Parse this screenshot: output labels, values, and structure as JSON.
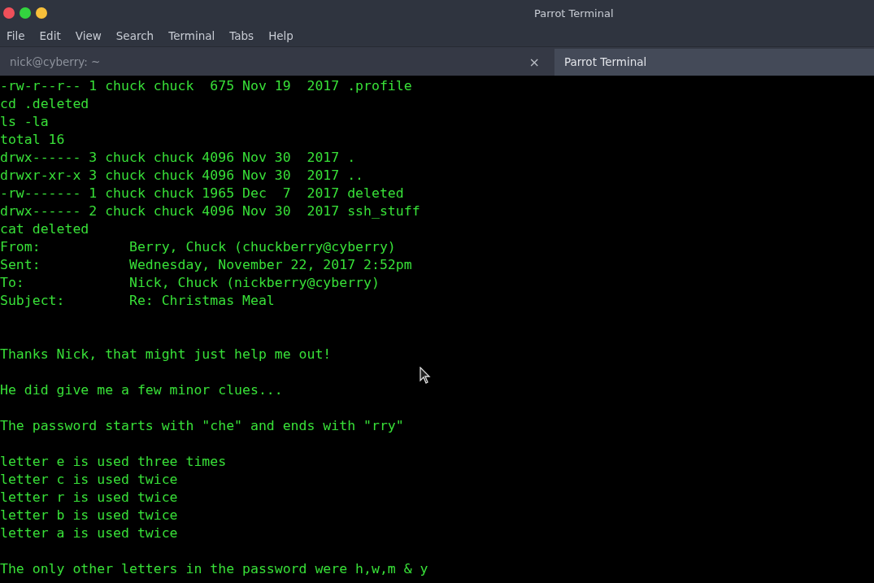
{
  "window": {
    "title": "Parrot Terminal",
    "controls": [
      {
        "color": "#f0505a"
      },
      {
        "color": "#33d43f"
      },
      {
        "color": "#f8c03a"
      }
    ]
  },
  "menu": [
    "File",
    "Edit",
    "View",
    "Search",
    "Terminal",
    "Tabs",
    "Help"
  ],
  "tabs": [
    {
      "label": "nick@cyberry: ~",
      "close": "×",
      "selected": false
    },
    {
      "label": "Parrot Terminal",
      "selected": true
    }
  ],
  "terminal": {
    "lines": [
      {
        "kind": "text",
        "text": "-rw-r--r-- 1 chuck chuck  675 Nov 19  2017 .profile"
      },
      {
        "kind": "text",
        "text": "cd .deleted"
      },
      {
        "kind": "text",
        "text": "ls -la"
      },
      {
        "kind": "text",
        "text": "total 16"
      },
      {
        "kind": "text",
        "text": "drwx------ 3 chuck chuck 4096 Nov 30  2017 ."
      },
      {
        "kind": "text",
        "text": "drwxr-xr-x 3 chuck chuck 4096 Nov 30  2017 .."
      },
      {
        "kind": "text",
        "text": "-rw------- 1 chuck chuck 1965 Dec  7  2017 deleted"
      },
      {
        "kind": "text",
        "text": "drwx------ 2 chuck chuck 4096 Nov 30  2017 ssh_stuff"
      },
      {
        "kind": "text",
        "text": "cat deleted"
      },
      {
        "kind": "text",
        "text": "From:           Berry, Chuck (chuckberry@cyberry)"
      },
      {
        "kind": "text",
        "text": "Sent:           Wednesday, November 22, 2017 2:52pm"
      },
      {
        "kind": "text",
        "text": "To:             Nick, Chuck (nickberry@cyberry)"
      },
      {
        "kind": "text",
        "text": "Subject:        Re: Christmas Meal"
      },
      {
        "kind": "blank"
      },
      {
        "kind": "blank"
      },
      {
        "kind": "text",
        "text": "Thanks Nick, that might just help me out!"
      },
      {
        "kind": "blank"
      },
      {
        "kind": "text",
        "text": "He did give me a few minor clues..."
      },
      {
        "kind": "blank"
      },
      {
        "kind": "text",
        "text": "The password starts with \"che\" and ends with \"rry\""
      },
      {
        "kind": "blank"
      },
      {
        "kind": "text",
        "text": "letter e is used three times"
      },
      {
        "kind": "text",
        "text": "letter c is used twice"
      },
      {
        "kind": "text",
        "text": "letter r is used twice"
      },
      {
        "kind": "text",
        "text": "letter b is used twice"
      },
      {
        "kind": "text",
        "text": "letter a is used twice"
      },
      {
        "kind": "blank"
      },
      {
        "kind": "text",
        "text": "The only other letters in the password were h,w,m & y"
      }
    ]
  }
}
